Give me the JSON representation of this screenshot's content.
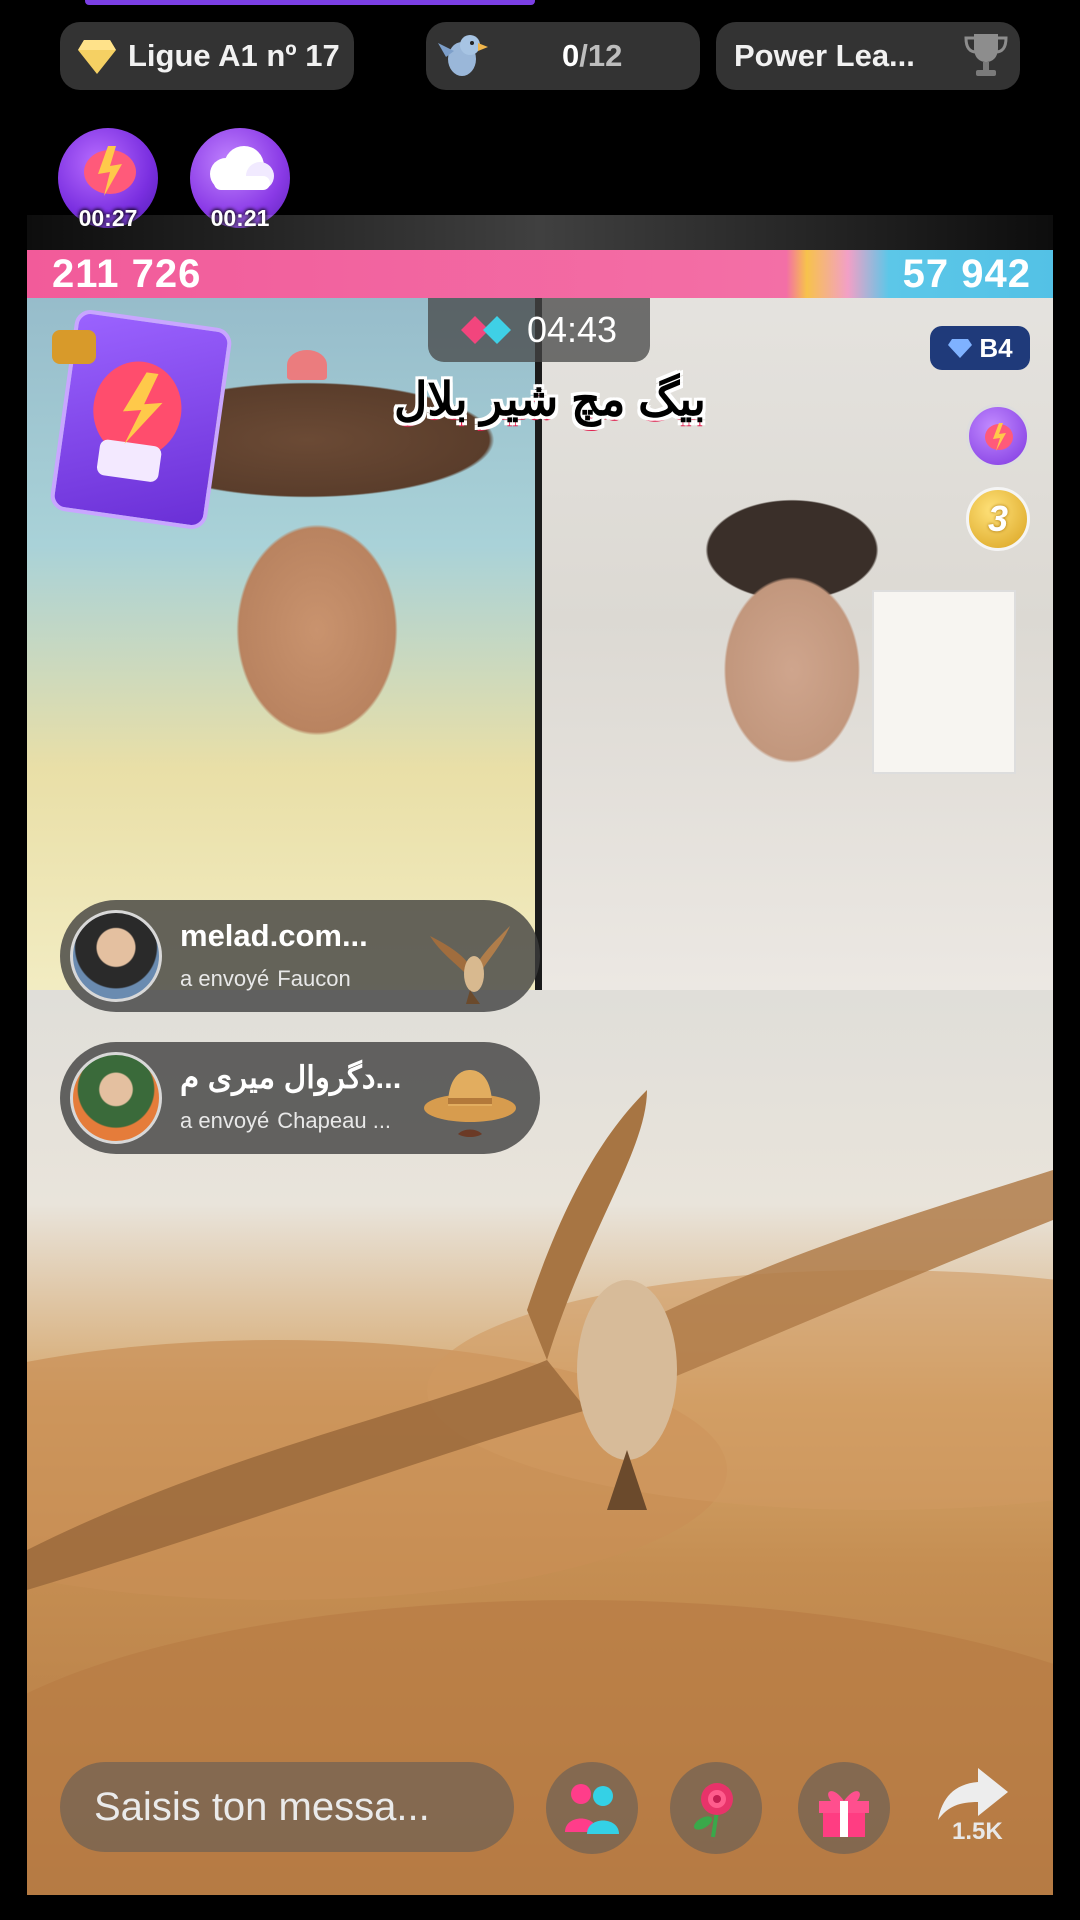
{
  "header": {
    "league_label": "Ligue A1 nº 17",
    "progress_current": "0",
    "progress_total": "/12",
    "power_league_label": "Power Lea..."
  },
  "boosters": [
    {
      "icon": "lightning-glove-icon",
      "timer": "00:27"
    },
    {
      "icon": "cloud-icon",
      "timer": "00:21"
    }
  ],
  "battle": {
    "left_score": "211 726",
    "right_score": "57 942",
    "timer": "04:43",
    "title": "بیگ مچ شیر بلال",
    "rank_badge": "B4",
    "multiplier_badge": "3"
  },
  "gift_feed": [
    {
      "user": "melad.com...",
      "action": "a envoyé",
      "gift": "Faucon",
      "gift_icon": "falcon-icon"
    },
    {
      "user": "دگروال میری م...",
      "action": "a envoyé",
      "gift": "Chapeau ...",
      "gift_icon": "hat-icon"
    }
  ],
  "footer": {
    "message_placeholder": "Saisis ton messa...",
    "share_count": "1.5K"
  },
  "colors": {
    "left_team": "#f25b9a",
    "right_team": "#53c1e6",
    "title_outline": "#e0204f"
  }
}
